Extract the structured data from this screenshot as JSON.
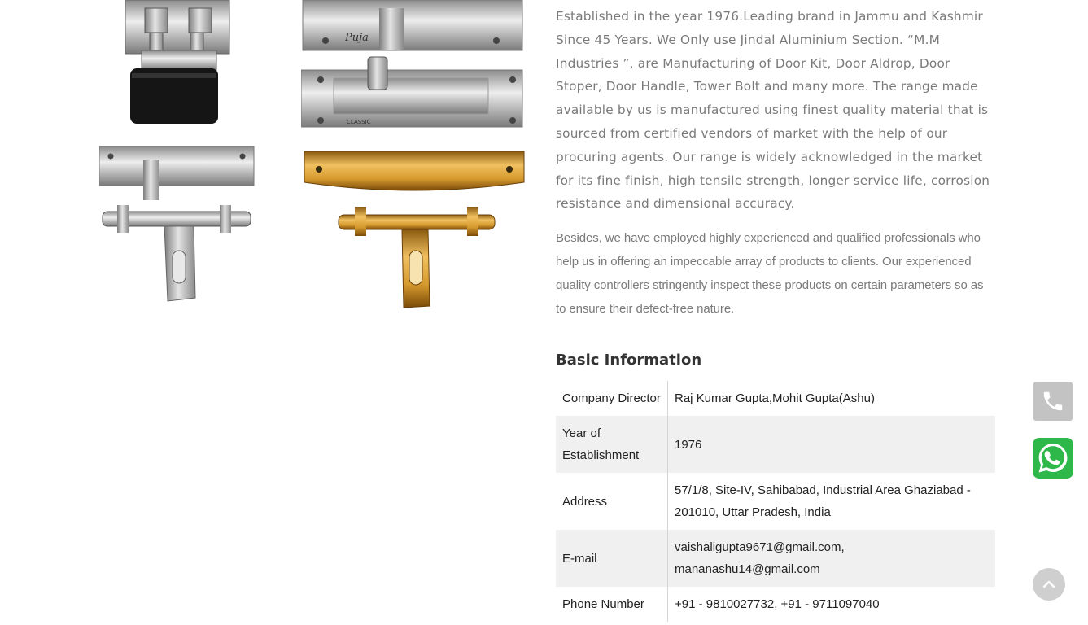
{
  "about": {
    "paragraph1": "Established in the year 1976.Leading brand in Jammu and Kashmir Since 45 Years. We Only use Jindal Aluminium Section. “M.M Industries ”, are Manufacturing of Door Kit, Door Aldrop, Door Stoper, Door Handle, Tower Bolt and many more. The range made available by us is manufactured using finest quality material that is sourced from certified vendors of market with the help of our procuring agents. Our range is widely acknowledged in the market for its fine finish, high tensile strength, longer service life, corrosion resistance and dimensional accuracy.",
    "paragraph2": "Besides, we have employed highly experienced and qualified professionals who help us in offering an impeccable array of products to clients. Our experienced quality controllers stringently inspect these products on certain parameters so as to ensure their defect-free nature."
  },
  "basic_info": {
    "title": "Basic Information",
    "rows": [
      {
        "label": "Company Director",
        "value": "Raj Kumar Gupta,Mohit Gupta(Ashu)"
      },
      {
        "label": "Year of Establishment",
        "value": "1976"
      },
      {
        "label": "Address",
        "value": "57/1/8, Site-IV, Sahibabad, Industrial Area Ghaziabad - 201010, Uttar Pradesh, India"
      },
      {
        "label": "E-mail",
        "value": "vaishaligupta9671@gmail.com, mananashu14@gmail.com"
      },
      {
        "label": "Phone Number",
        "value": "+91 - 9810027732, +91 - 9711097040"
      }
    ]
  },
  "products": {
    "logo_text_1": "Puja",
    "logo_text_2": "CLASSIC"
  },
  "icons": {
    "phone": "phone-icon",
    "whatsapp": "whatsapp-icon",
    "scroll_top": "chevron-up-icon"
  },
  "colors": {
    "text_gray": "#7a7a7a",
    "whatsapp_green": "#2fb84a",
    "phone_button": "#c3c3c3"
  }
}
